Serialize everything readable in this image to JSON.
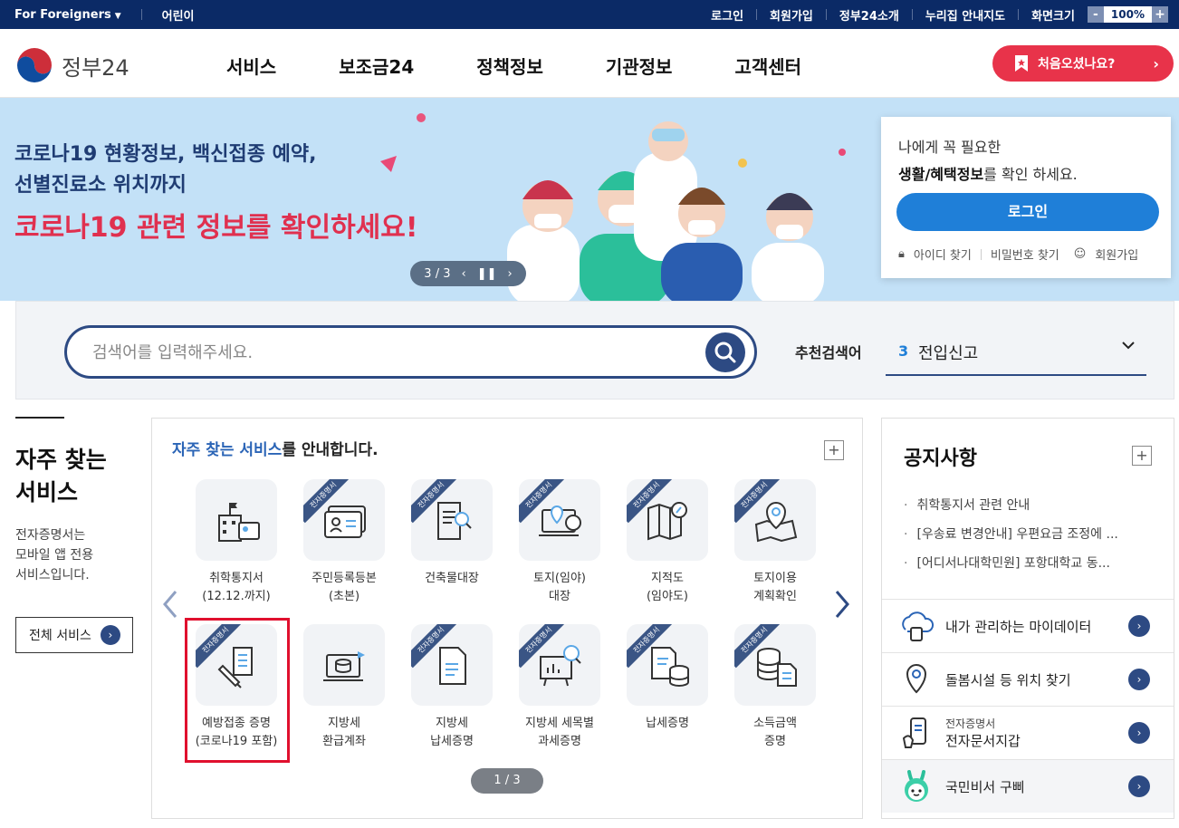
{
  "topbar": {
    "foreigners": "For Foreigners",
    "kids": "어린이",
    "login": "로그인",
    "signup": "회원가입",
    "about": "정부24소개",
    "map": "누리집 안내지도",
    "zoom_label": "화면크기",
    "zoom_value": "100%",
    "zoom_minus": "-",
    "zoom_plus": "+"
  },
  "header": {
    "logo_text": "정부24",
    "nav": [
      "서비스",
      "보조금24",
      "정책정보",
      "기관정보",
      "고객센터"
    ],
    "first_visit": "처음오셨나요?"
  },
  "banner": {
    "line1": "코로나19 현황정보, 백신접종 예약,",
    "line2": "선별진료소 위치까지",
    "line3": "코로나19 관련 정보를 확인하세요!",
    "pager": "3 / 3"
  },
  "login_card": {
    "msg1": "나에게 꼭 필요한",
    "msg2_bold": "생활/혜택정보",
    "msg2_rest": "를 확인 하세요.",
    "button": "로그인",
    "find_id": "아이디 찾기",
    "find_pw": "비밀번호 찾기",
    "join": "회원가입"
  },
  "search": {
    "placeholder": "검색어를 입력해주세요.",
    "rec_label": "추천검색어",
    "rec_num": "3",
    "rec_term": "전입신고"
  },
  "side": {
    "title_1": "자주 찾는",
    "title_2": "서비스",
    "desc_1": "전자증명서는",
    "desc_2": "모바일 앱 전용",
    "desc_3": "서비스입니다.",
    "all_button": "전체 서비스"
  },
  "services": {
    "title_hl": "자주 찾는 서비스",
    "title_rest": "를 안내합니다.",
    "ribbon": "전자증명서",
    "tiles": [
      {
        "l1": "취학통지서",
        "l2": "(12.12.까지)"
      },
      {
        "l1": "주민등록등본",
        "l2": "(초본)"
      },
      {
        "l1": "건축물대장",
        "l2": ""
      },
      {
        "l1": "토지(임야)",
        "l2": "대장"
      },
      {
        "l1": "지적도",
        "l2": "(임야도)"
      },
      {
        "l1": "토지이용",
        "l2": "계획확인"
      },
      {
        "l1": "예방접종 증명",
        "l2": "(코로나19 포함)"
      },
      {
        "l1": "지방세",
        "l2": "환급계좌"
      },
      {
        "l1": "지방세",
        "l2": "납세증명"
      },
      {
        "l1": "지방세 세목별",
        "l2": "과세증명"
      },
      {
        "l1": "납세증명",
        "l2": ""
      },
      {
        "l1": "소득금액",
        "l2": "증명"
      }
    ],
    "pager": "1 / 3"
  },
  "notice": {
    "title": "공지사항",
    "items": [
      "취학통지서 관련 안내",
      "[우송료 변경안내] 우편요금 조정에 ...",
      "[어디서나대학민원] 포항대학교 동..."
    ],
    "links": [
      {
        "small": "",
        "text": "내가 관리하는 마이데이터"
      },
      {
        "small": "",
        "text": "돌봄시설 등 위치 찾기"
      },
      {
        "small": "전자증명서",
        "text": "전자문서지갑"
      },
      {
        "small": "",
        "text": "국민비서 구삐"
      }
    ]
  },
  "colors": {
    "topbar": "#0b2a66",
    "accent_red": "#e8334a",
    "primary_blue": "#1f7fd8",
    "navy": "#2d4a83",
    "banner_bg": "#c3e1f7"
  }
}
